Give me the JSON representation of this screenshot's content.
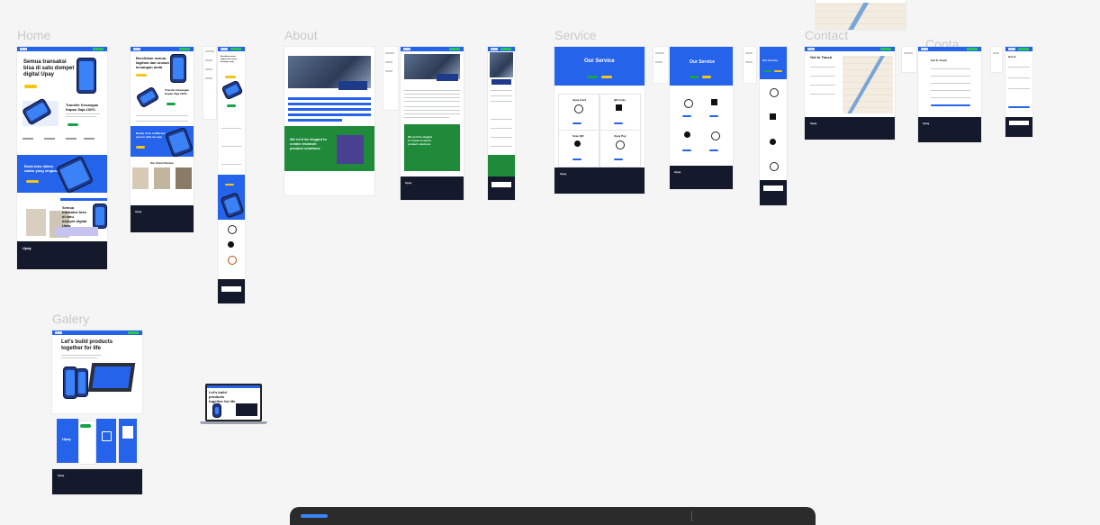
{
  "sections": {
    "home": "Home",
    "about": "About",
    "service": "Service",
    "contact": "Contact",
    "conta": "Conta",
    "galery": "Galery"
  },
  "home": {
    "hero_title": "Semua transaksi bisa di satu dompet digital Upay",
    "mobile_hero_title": "Bersihkan semua tagihan dan urusan keuangan anda",
    "transfer_title": "Transfer Keuangan Kapan Saja 100%",
    "banner_title": "Buka toko dalam waktu yang singkat",
    "mid_banner": "Ready to be a different person with our app",
    "our_client": "Our Client Review",
    "footer_brand": "Upay"
  },
  "about": {
    "banner_title": "We ne'd be elegant to create research product solutions",
    "footer_brand": "Upay"
  },
  "service": {
    "title": "Our Service",
    "cards": [
      "Upay Card",
      "QR Code",
      "Scan QR",
      "Upay Pay"
    ],
    "footer_brand": "Upay"
  },
  "contact": {
    "title": "Get In Touch",
    "title_short": "Get In",
    "footer_brand": "Upay"
  },
  "galery": {
    "title": "Let's build products together for life",
    "laptop_title": "Let's build products together for life",
    "app_brand": "Upay",
    "footer_brand": "Upay"
  },
  "colors": {
    "brand_blue": "#2563eb",
    "footer_dark": "#141a2b",
    "accent_yellow": "#f5c518",
    "accent_green": "#16a34a"
  }
}
